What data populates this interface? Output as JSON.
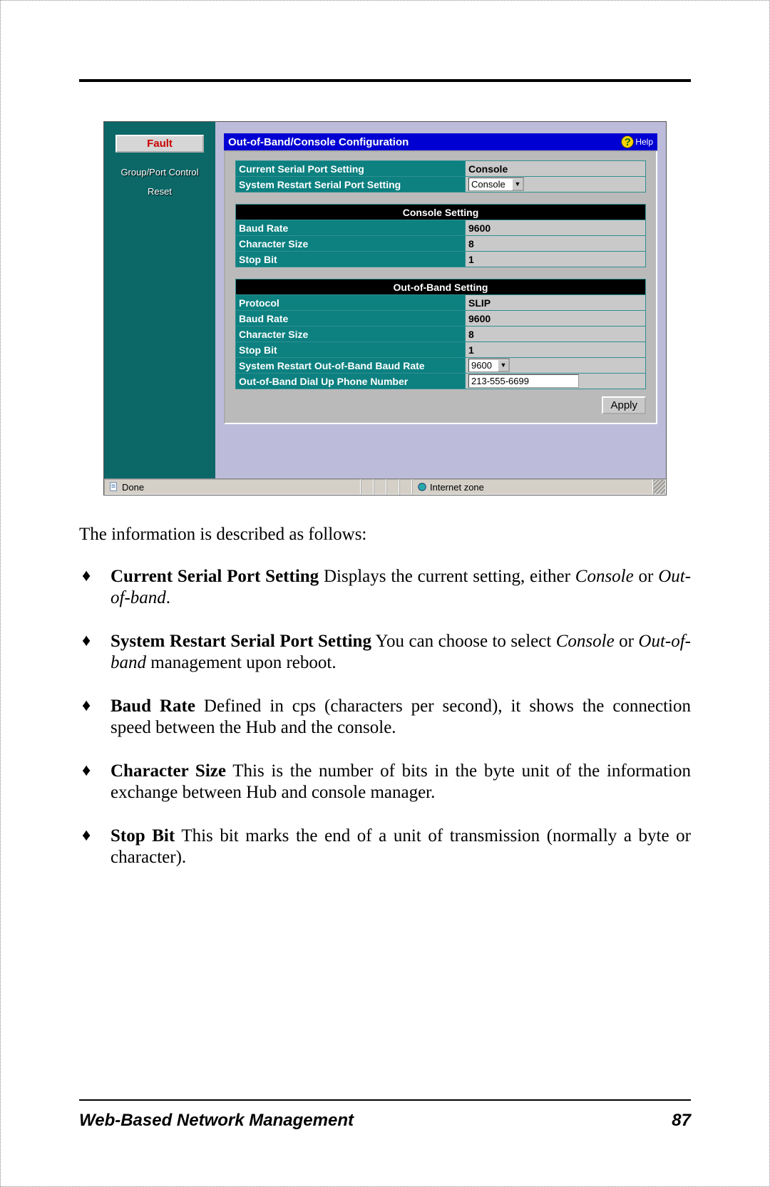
{
  "sidebar": {
    "fault_label": "Fault",
    "item_groupport": "Group/Port Control",
    "item_reset": "Reset"
  },
  "panel": {
    "title": "Out-of-Band/Console Configuration",
    "help_label": "Help",
    "apply_label": "Apply"
  },
  "topcfg": {
    "row1_label": "Current Serial Port Setting",
    "row1_value": "Console",
    "row2_label": "System Restart Serial Port Setting",
    "row2_value": "Console"
  },
  "console_setting": {
    "header": "Console Setting",
    "baud_label": "Baud Rate",
    "baud_value": "9600",
    "charsize_label": "Character Size",
    "charsize_value": "8",
    "stopbit_label": "Stop Bit",
    "stopbit_value": "1"
  },
  "oob_setting": {
    "header": "Out-of-Band Setting",
    "protocol_label": "Protocol",
    "protocol_value": "SLIP",
    "baud_label": "Baud Rate",
    "baud_value": "9600",
    "charsize_label": "Character Size",
    "charsize_value": "8",
    "stopbit_label": "Stop Bit",
    "stopbit_value": "1",
    "restart_baud_label": "System Restart Out-of-Band Baud Rate",
    "restart_baud_value": "9600",
    "dialup_label": "Out-of-Band Dial Up Phone Number",
    "dialup_value": "213-555-6699"
  },
  "statusbar": {
    "left": "Done",
    "right": "Internet zone"
  },
  "body": {
    "intro": "The information is described as follows:",
    "items": [
      {
        "term": "Current Serial Port Setting",
        "sep": "    ",
        "pre": "Displays the current setting, either ",
        "it1": "Console",
        "mid": " or ",
        "it2": "Out-of-band",
        "post": "."
      },
      {
        "term": "System Restart Serial Port Setting",
        "sep": "    ",
        "pre": "You can choose to select ",
        "it1": "Console",
        "mid": " or ",
        "it2": "Out-of-band",
        "post": " management upon reboot."
      },
      {
        "term": "Baud Rate",
        "sep": "    ",
        "full": "Defined in cps (characters per second), it shows the connection speed between the Hub and the console."
      },
      {
        "term": "Character Size",
        "sep": "    ",
        "full": "This is the number of bits in the byte unit of the information exchange between Hub and console manager."
      },
      {
        "term": "Stop Bit",
        "sep": "    ",
        "full": "This bit marks the end of a unit of transmission (normally a byte or character)."
      }
    ]
  },
  "footer": {
    "title": "Web-Based Network Management",
    "page": "87"
  }
}
